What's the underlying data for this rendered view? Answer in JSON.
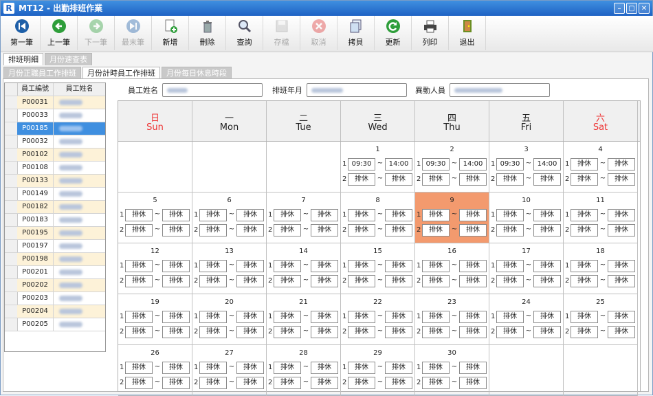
{
  "window": {
    "icon_letter": "R",
    "title": "MT12 - 出勤排班作業",
    "buttons": [
      "–",
      "▢",
      "✕"
    ]
  },
  "toolbar": [
    {
      "label": "第一筆",
      "icon": "first-record-icon",
      "enabled": true
    },
    {
      "label": "上一筆",
      "icon": "previous-record-icon",
      "enabled": true
    },
    {
      "label": "下一筆",
      "icon": "next-record-icon",
      "enabled": false
    },
    {
      "label": "最末筆",
      "icon": "last-record-icon",
      "enabled": false
    },
    {
      "label": "新增",
      "icon": "new-document-icon",
      "enabled": true
    },
    {
      "label": "刪除",
      "icon": "trash-icon",
      "enabled": true
    },
    {
      "label": "查詢",
      "icon": "search-icon",
      "enabled": true
    },
    {
      "label": "存檔",
      "icon": "save-icon",
      "enabled": false
    },
    {
      "label": "取消",
      "icon": "cancel-icon",
      "enabled": false
    },
    {
      "label": "拷貝",
      "icon": "copy-icon",
      "enabled": true
    },
    {
      "label": "更新",
      "icon": "refresh-icon",
      "enabled": true
    },
    {
      "label": "列印",
      "icon": "printer-icon",
      "enabled": true
    },
    {
      "label": "退出",
      "icon": "exit-door-icon",
      "enabled": true
    }
  ],
  "tabs_main": [
    {
      "label": "排班明細",
      "active": true
    },
    {
      "label": "月份速查表",
      "active": false
    }
  ],
  "tabs_sub": [
    {
      "label": "月份正職員工作排班",
      "active": false
    },
    {
      "label": "月份計時員工作排班",
      "active": true
    },
    {
      "label": "月份每日休息時段",
      "active": false
    }
  ],
  "employee_table": {
    "headers": [
      "員工編號",
      "員工姓名"
    ],
    "rows": [
      {
        "id": "P00031",
        "alt": true
      },
      {
        "id": "P00033",
        "alt": false
      },
      {
        "id": "P00185",
        "alt": false,
        "selected": true
      },
      {
        "id": "P00032",
        "alt": false
      },
      {
        "id": "P00102",
        "alt": true
      },
      {
        "id": "P00108",
        "alt": false
      },
      {
        "id": "P00133",
        "alt": true
      },
      {
        "id": "P00149",
        "alt": false
      },
      {
        "id": "P00182",
        "alt": true
      },
      {
        "id": "P00183",
        "alt": false
      },
      {
        "id": "P00195",
        "alt": true
      },
      {
        "id": "P00197",
        "alt": false
      },
      {
        "id": "P00198",
        "alt": true
      },
      {
        "id": "P00201",
        "alt": false
      },
      {
        "id": "P00202",
        "alt": true
      },
      {
        "id": "P00203",
        "alt": false
      },
      {
        "id": "P00204",
        "alt": true
      },
      {
        "id": "P00205",
        "alt": false
      }
    ]
  },
  "form": {
    "employee_name_label": "員工姓名",
    "schedule_month_label": "排班年月",
    "modified_by_label": "異動人員"
  },
  "calendar": {
    "weekdays": [
      {
        "zh": "日",
        "en": "Sun",
        "weekend": true
      },
      {
        "zh": "一",
        "en": "Mon",
        "weekend": false
      },
      {
        "zh": "二",
        "en": "Tue",
        "weekend": false
      },
      {
        "zh": "三",
        "en": "Wed",
        "weekend": false
      },
      {
        "zh": "四",
        "en": "Thu",
        "weekend": false
      },
      {
        "zh": "五",
        "en": "Fri",
        "weekend": false
      },
      {
        "zh": "六",
        "en": "Sat",
        "weekend": true
      }
    ],
    "first_weekday": 3,
    "days_in_month": 30,
    "today": 9,
    "today_color": "#f39a6e",
    "rest_label": "排休",
    "tilde": "~",
    "slot_numbers": [
      "1",
      "2"
    ],
    "shifts": {
      "1": [
        [
          "09:30",
          "14:00"
        ],
        [
          "排休",
          "排休"
        ]
      ],
      "2": [
        [
          "09:30",
          "14:00"
        ],
        [
          "排休",
          "排休"
        ]
      ],
      "3": [
        [
          "09:30",
          "14:00"
        ],
        [
          "排休",
          "排休"
        ]
      ]
    }
  }
}
